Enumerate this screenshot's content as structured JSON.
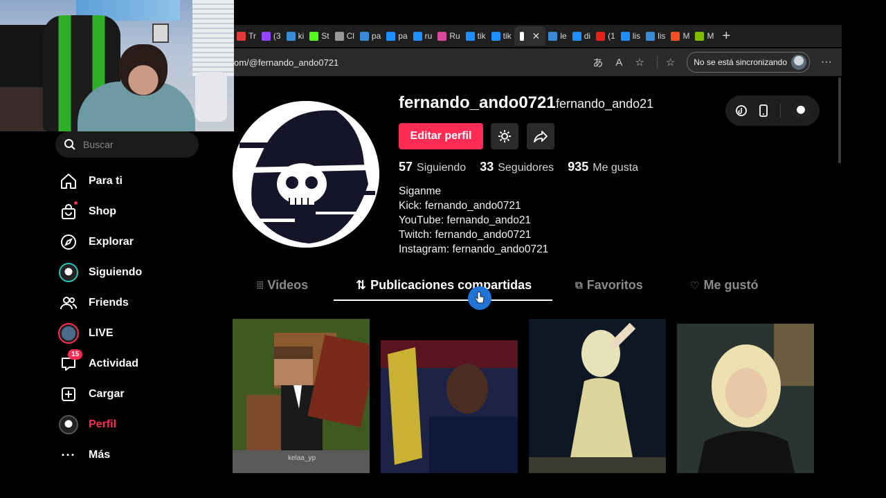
{
  "browser": {
    "tabs": [
      {
        "label": "Tr",
        "color": "#e03a3a"
      },
      {
        "label": "(3",
        "color": "#9146ff"
      },
      {
        "label": "ki",
        "color": "#3a8ad6"
      },
      {
        "label": "St",
        "color": "#53fc18"
      },
      {
        "label": "Cl",
        "color": "#9a9a9a"
      },
      {
        "label": "pa",
        "color": "#3a8ad6"
      },
      {
        "label": "pa",
        "color": "#1f8fff"
      },
      {
        "label": "ru",
        "color": "#1f8fff"
      },
      {
        "label": "Ru",
        "color": "#d64b9a"
      },
      {
        "label": "tik",
        "color": "#1f8fff"
      },
      {
        "label": "tik",
        "color": "#1f8fff"
      }
    ],
    "active_tab": {
      "label": "t",
      "color": "#ffffff"
    },
    "tabs_right": [
      {
        "label": "le",
        "color": "#3a8ad6"
      },
      {
        "label": "di",
        "color": "#1f8fff"
      },
      {
        "label": "(1",
        "color": "#e62117"
      },
      {
        "label": "lis",
        "color": "#1f8fff"
      },
      {
        "label": "lis",
        "color": "#3a8ad6"
      },
      {
        "label": "M",
        "color": "#f25022"
      },
      {
        "label": "M",
        "color": "#7fba00"
      }
    ],
    "url": "om/@fernando_ando0721",
    "sync_label": "No se está sincronizando"
  },
  "sidebar": {
    "search_placeholder": "Buscar",
    "items": [
      {
        "label": "Para ti",
        "icon": "home-icon"
      },
      {
        "label": "Shop",
        "icon": "shop-icon"
      },
      {
        "label": "Explorar",
        "icon": "compass-icon"
      },
      {
        "label": "Siguiendo",
        "icon": "following-avatar"
      },
      {
        "label": "Friends",
        "icon": "friends-icon"
      },
      {
        "label": "LIVE",
        "icon": "live-icon"
      },
      {
        "label": "Actividad",
        "icon": "inbox-icon",
        "badge": "15"
      },
      {
        "label": "Cargar",
        "icon": "upload-icon"
      },
      {
        "label": "Perfil",
        "icon": "profile-avatar"
      },
      {
        "label": "Más",
        "icon": "more-icon"
      }
    ]
  },
  "profile": {
    "username": "fernando_ando0721",
    "nickname": "fernando_ando21",
    "edit_button": "Editar perfil",
    "stats": [
      {
        "value": "57",
        "label": "Siguiendo"
      },
      {
        "value": "33",
        "label": "Seguidores"
      },
      {
        "value": "935",
        "label": "Me gusta"
      }
    ],
    "bio": [
      "Siganme",
      "Kick: fernando_ando0721",
      "YouTube: fernando_ando21",
      "Twitch: fernando_ando0721",
      "Instagram: fernando_ando0721"
    ]
  },
  "tabs": [
    {
      "label": "Videos"
    },
    {
      "label": "Publicaciones compartidas"
    },
    {
      "label": "Favoritos"
    },
    {
      "label": "Me gustó"
    }
  ],
  "active_tab_index": 1,
  "videos": [
    {
      "watermark": "kelaa_yp"
    },
    {
      "caption": ""
    },
    {
      "caption": ""
    },
    {
      "caption": ""
    }
  ],
  "colors": {
    "accent": "#fe2c55",
    "cursor": "#1f74d6"
  }
}
